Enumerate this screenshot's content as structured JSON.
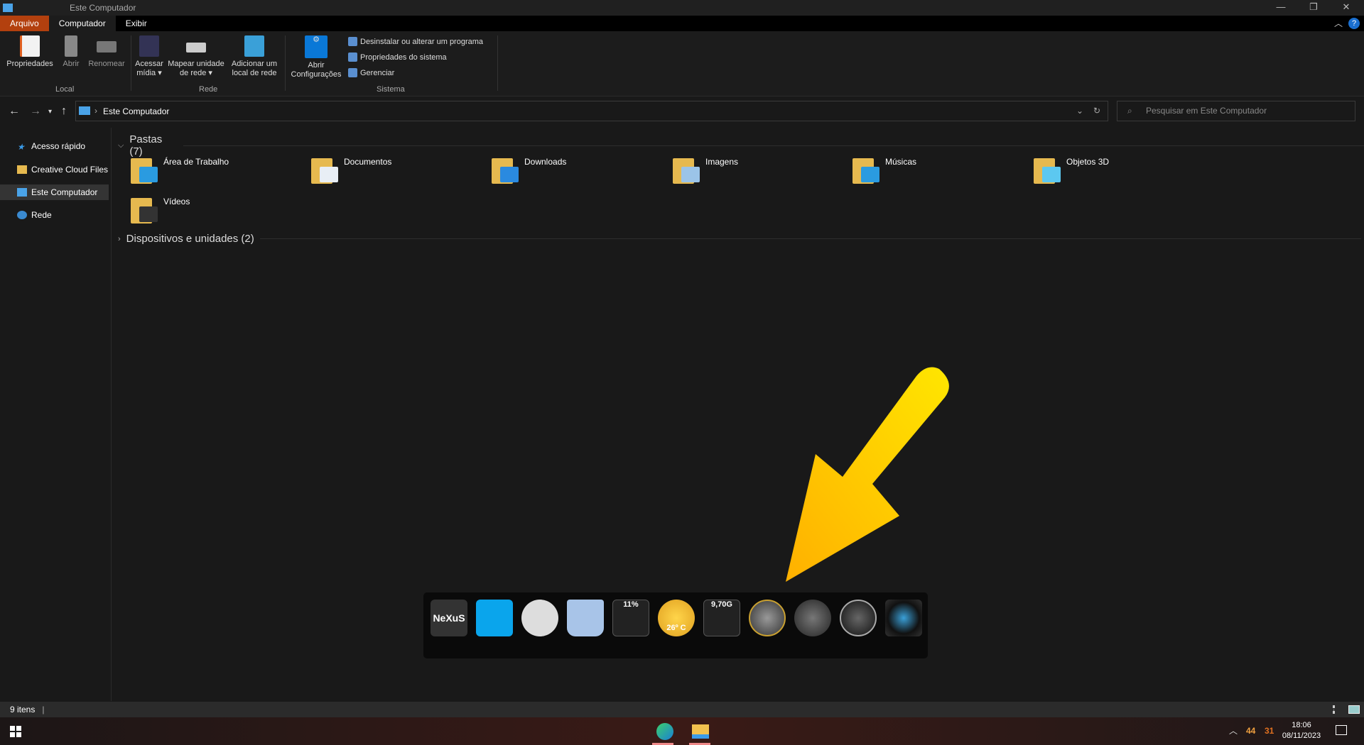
{
  "window": {
    "title": "Este Computador",
    "minimize": "—",
    "maximize": "❐",
    "close": "✕"
  },
  "ribbon_tabs": [
    "Arquivo",
    "Computador",
    "Exibir"
  ],
  "ribbon": {
    "local": {
      "label": "Local",
      "buttons": [
        "Propriedades",
        "Abrir",
        "Renomear"
      ]
    },
    "rede": {
      "label": "Rede",
      "buttons": [
        "Acessar mídia ▾",
        "Mapear unidade de rede ▾",
        "Adicionar um local de rede"
      ]
    },
    "sistema": {
      "label": "Sistema",
      "open_settings": "Abrir Configurações",
      "items": [
        "Desinstalar ou alterar um programa",
        "Propriedades do sistema",
        "Gerenciar"
      ]
    }
  },
  "address": {
    "path": "Este Computador",
    "search_placeholder": "Pesquisar em Este Computador"
  },
  "sidebar": {
    "items": [
      {
        "label": "Acesso rápido"
      },
      {
        "label": "Creative Cloud Files"
      },
      {
        "label": "Este Computador",
        "selected": true
      },
      {
        "label": "Rede"
      }
    ]
  },
  "sections": {
    "folders": "Pastas (7)",
    "devices": "Dispositivos e unidades (2)"
  },
  "folders": [
    {
      "label": "Área de Trabalho",
      "color": "#2a9be0"
    },
    {
      "label": "Documentos",
      "color": "#e8eef5"
    },
    {
      "label": "Downloads",
      "color": "#2a8ae0"
    },
    {
      "label": "Imagens",
      "color": "#9bc4e8"
    },
    {
      "label": "Músicas",
      "color": "#2a9be0"
    },
    {
      "label": "Objetos 3D",
      "color": "#5cc8f0"
    },
    {
      "label": "Vídeos",
      "color": "#333"
    }
  ],
  "status": {
    "count": "9 itens"
  },
  "dock": {
    "items": [
      "nexus",
      "windows",
      "clock",
      "recycle-bin",
      "cpu-meter",
      "weather",
      "ram-meter",
      "internet",
      "power",
      "music",
      "camera"
    ],
    "nexus_label": "NeXuS",
    "cpu": "11%",
    "weather": "26º C",
    "ram": "9,70G"
  },
  "tray": {
    "time": "18:06",
    "date": "08/11/2023",
    "ind1": "44",
    "ind2": "31"
  },
  "annotation": {
    "arrow_color": "#ffc400"
  }
}
